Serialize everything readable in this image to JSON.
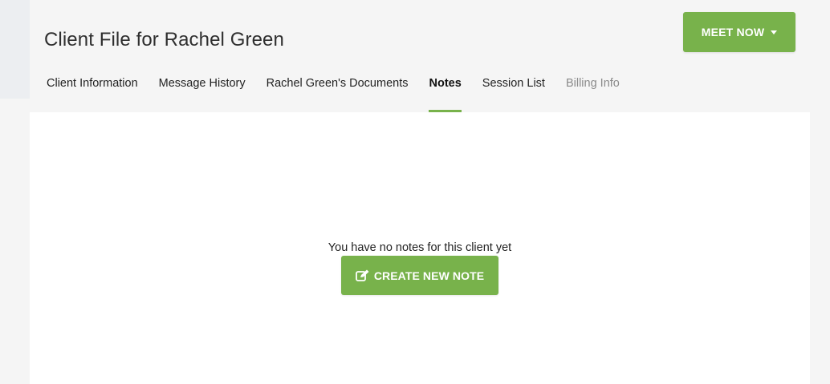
{
  "header": {
    "title": "Client File for Rachel Green",
    "meet_button_label": "MEET NOW"
  },
  "tabs": [
    {
      "label": "Client Information",
      "state": "normal"
    },
    {
      "label": "Message History",
      "state": "normal"
    },
    {
      "label": "Rachel Green's Documents",
      "state": "normal"
    },
    {
      "label": "Notes",
      "state": "active"
    },
    {
      "label": "Session List",
      "state": "normal"
    },
    {
      "label": "Billing Info",
      "state": "muted"
    }
  ],
  "notes": {
    "empty_message": "You have no notes for this client yet",
    "create_button_label": "CREATE NEW NOTE",
    "create_button_icon": "edit-icon"
  },
  "colors": {
    "accent": "#78b24b",
    "header_bg": "#f5f5f5",
    "content_bg": "#ffffff",
    "muted_text": "#8a8a8a"
  }
}
